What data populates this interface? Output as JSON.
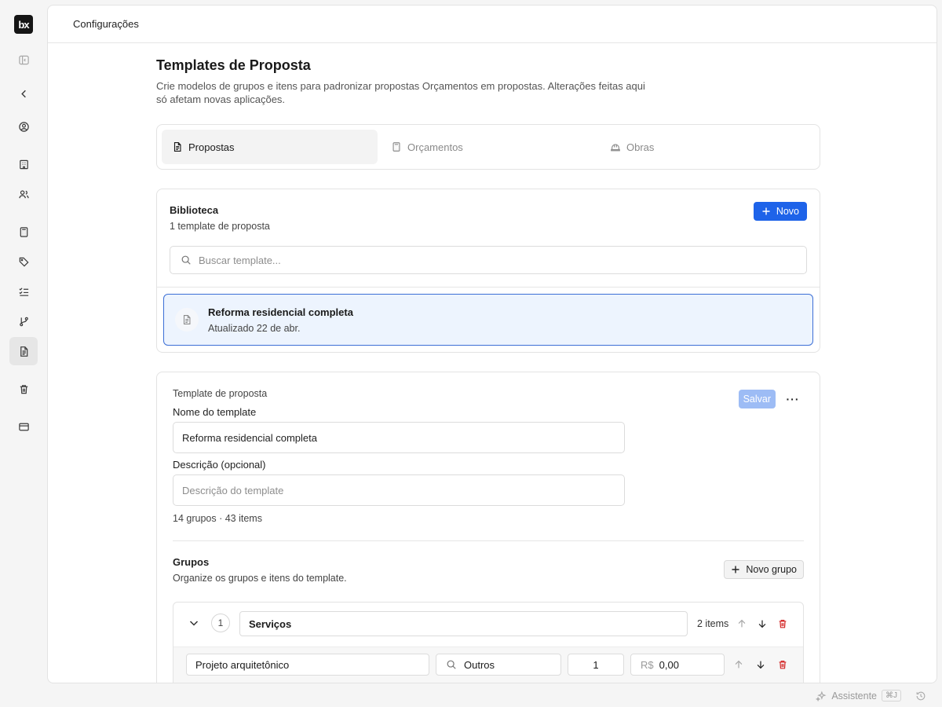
{
  "brand": {
    "logo_text": "bx"
  },
  "sidebar": {
    "items": [
      {
        "name": "toggle-sidebar",
        "icon": "sidebar-toggle-icon"
      },
      {
        "name": "back",
        "icon": "chevron-left-icon"
      },
      {
        "name": "profile",
        "icon": "user-circle-icon"
      },
      {
        "name": "company",
        "icon": "building-icon"
      },
      {
        "name": "users",
        "icon": "users-icon"
      },
      {
        "name": "calculator",
        "icon": "calculator-icon"
      },
      {
        "name": "tags",
        "icon": "tag-icon"
      },
      {
        "name": "checklist",
        "icon": "list-checks-icon"
      },
      {
        "name": "workflow",
        "icon": "git-branch-icon"
      },
      {
        "name": "templates",
        "icon": "file-text-icon",
        "active": true
      },
      {
        "name": "trash",
        "icon": "trash-icon"
      },
      {
        "name": "billing",
        "icon": "credit-card-icon"
      }
    ]
  },
  "topbar": {
    "title": "Configurações"
  },
  "page": {
    "title": "Templates de Proposta",
    "description": "Crie modelos de grupos e itens para padronizar propostas Orçamentos em propostas. Alterações feitas aqui só afetam novas aplicações."
  },
  "tabs": [
    {
      "label": "Propostas",
      "active": true
    },
    {
      "label": "Orçamentos",
      "active": false
    },
    {
      "label": "Obras",
      "active": false
    }
  ],
  "library": {
    "title": "Biblioteca",
    "count_text": "1 template de proposta",
    "new_button": "Novo",
    "search_placeholder": "Buscar template...",
    "templates": [
      {
        "name": "Reforma residencial completa",
        "updated": "Atualizado 22 de abr."
      }
    ]
  },
  "editor": {
    "section_label": "Template de proposta",
    "save_button": "Salvar",
    "more_button": "···",
    "name_label": "Nome do template",
    "name_value": "Reforma residencial completa",
    "desc_label": "Descrição (opcional)",
    "desc_value": "",
    "desc_placeholder": "Descrição do template",
    "counts": "14 grupos · 43 items",
    "groups_title": "Grupos",
    "groups_subtitle": "Organize os grupos e itens do template.",
    "new_group_button": "Novo grupo",
    "groups": [
      {
        "number": "1",
        "name": "Serviços",
        "items_count": "2 items",
        "items": [
          {
            "name": "Projeto arquitetônico",
            "category": "Outros",
            "quantity": "1",
            "currency": "R$",
            "price": "0,00"
          }
        ]
      }
    ]
  },
  "footer": {
    "assistant_label": "Assistente",
    "assistant_shortcut": "⌘J"
  },
  "colors": {
    "primary": "#1e63e9",
    "primary_disabled": "#9dbcf5",
    "selected_bg": "#edf4fe",
    "danger": "#d42a2a"
  }
}
